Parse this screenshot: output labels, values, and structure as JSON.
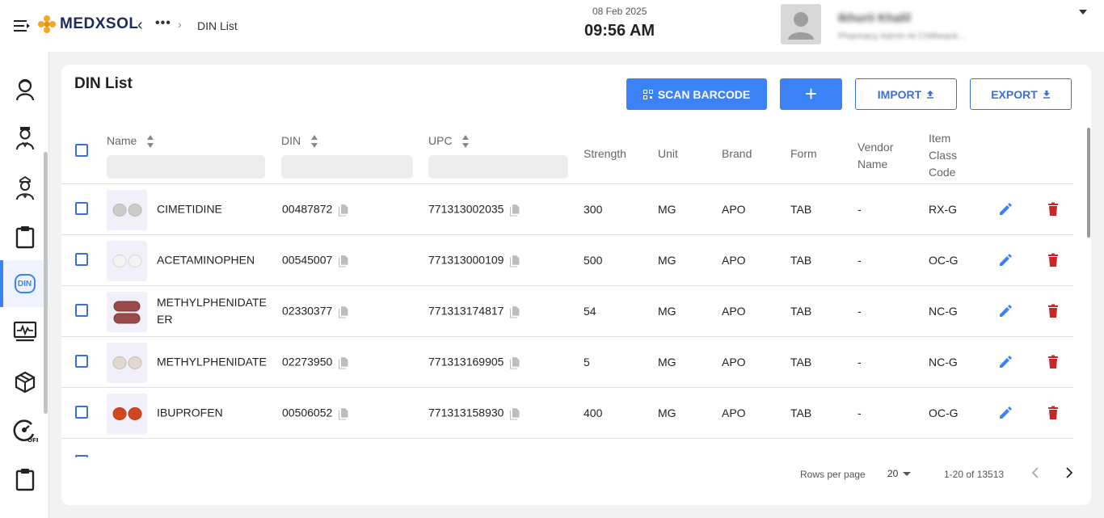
{
  "header": {
    "logo_text": "MEDXSOL",
    "back_glyph": "‹",
    "more_glyph": "•••",
    "separator": "›",
    "breadcrumb_current": "DIN List",
    "date": "08 Feb 2025",
    "time": "09:56 AM",
    "user_name": "Ikhurii Khalil",
    "user_role": "Pharmacy Admin At Chilliwack..."
  },
  "sidebar": {
    "items": [
      {
        "icon": "user-female-icon"
      },
      {
        "icon": "doctor-icon"
      },
      {
        "icon": "nurse-icon"
      },
      {
        "icon": "clipboard-icon"
      },
      {
        "icon": "din-icon",
        "label": "DIN",
        "active": true
      },
      {
        "icon": "monitor-pulse-icon"
      },
      {
        "icon": "box-icon"
      },
      {
        "icon": "gauge-off-icon",
        "badge": "OFF"
      },
      {
        "icon": "clipboard-icon"
      }
    ]
  },
  "main": {
    "title": "DIN List",
    "buttons": {
      "scan": "SCAN BARCODE",
      "add": "+",
      "import": "IMPORT",
      "export": "EXPORT"
    },
    "columns": {
      "name": "Name",
      "din": "DIN",
      "upc": "UPC",
      "strength": "Strength",
      "unit": "Unit",
      "brand": "Brand",
      "form": "Form",
      "vendor": "Vendor Name",
      "item_class": "Item Class Code"
    },
    "rows": [
      {
        "name": "CIMETIDINE",
        "din": "00487872",
        "upc": "771313002035",
        "strength": "300",
        "unit": "MG",
        "brand": "APO",
        "form": "TAB",
        "vendor": "-",
        "item_class": "RX-G",
        "pill": "grey"
      },
      {
        "name": "ACETAMINOPHEN",
        "din": "00545007",
        "upc": "771313000109",
        "strength": "500",
        "unit": "MG",
        "brand": "APO",
        "form": "TAB",
        "vendor": "-",
        "item_class": "OC-G",
        "pill": "white"
      },
      {
        "name": "METHYLPHENIDATE ER",
        "din": "02330377",
        "upc": "771313174817",
        "strength": "54",
        "unit": "MG",
        "brand": "APO",
        "form": "TAB",
        "vendor": "-",
        "item_class": "NC-G",
        "pill": "maroon"
      },
      {
        "name": "METHYLPHENIDATE",
        "din": "02273950",
        "upc": "771313169905",
        "strength": "5",
        "unit": "MG",
        "brand": "APO",
        "form": "TAB",
        "vendor": "-",
        "item_class": "NC-G",
        "pill": "beige"
      },
      {
        "name": "IBUPROFEN",
        "din": "00506052",
        "upc": "771313158930",
        "strength": "400",
        "unit": "MG",
        "brand": "APO",
        "form": "TAB",
        "vendor": "-",
        "item_class": "OC-G",
        "pill": "orange"
      }
    ],
    "pagination": {
      "rows_per_page_label": "Rows per page",
      "rows_per_page": "20",
      "range": "1-20 of 13513"
    }
  },
  "colors": {
    "accent": "#3b82f6",
    "delete": "#c62828",
    "edit": "#3b82f6"
  }
}
